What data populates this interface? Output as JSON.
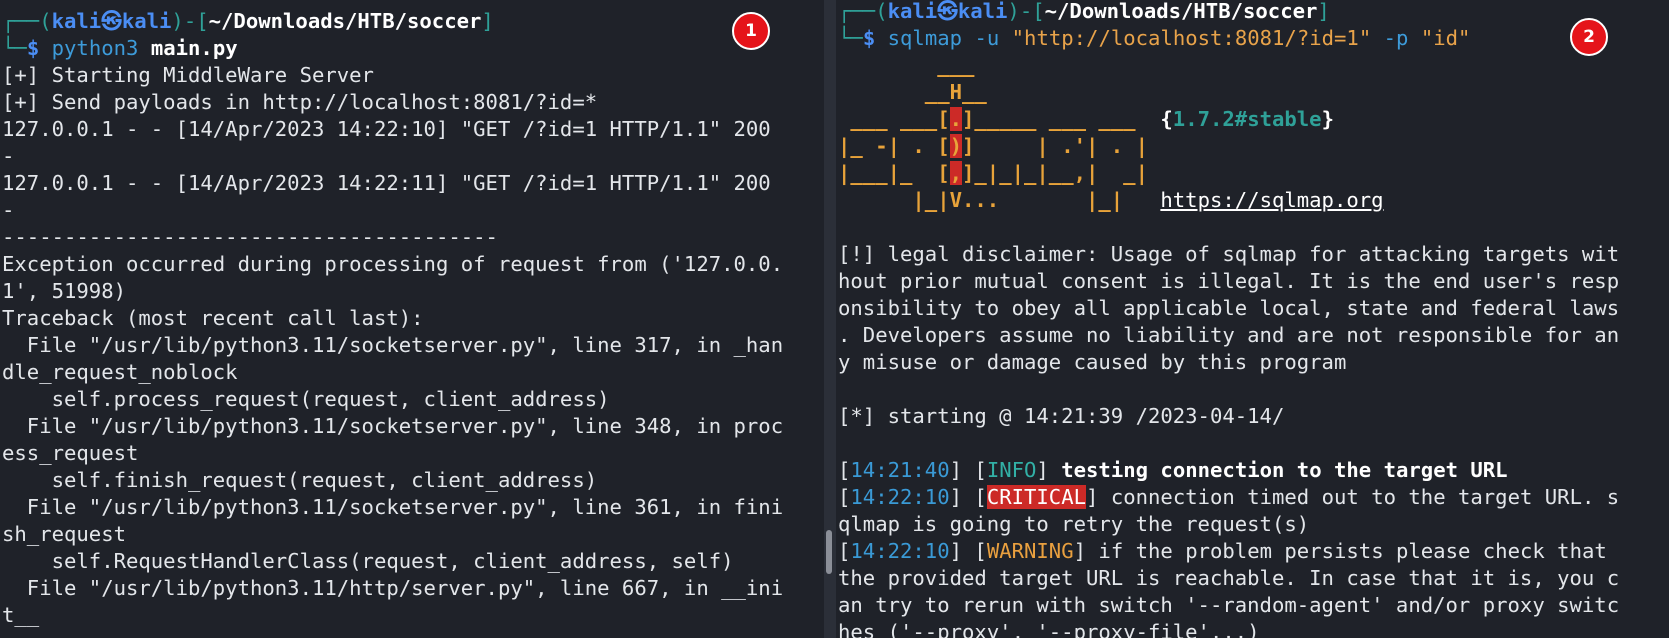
{
  "left": {
    "badge": "1",
    "prompt": {
      "line1_prefix": "┌──(",
      "user": "kali",
      "skull": "㉿",
      "host": "kali",
      "mid": ")-[",
      "path": "~/Downloads/HTB/soccer",
      "end": "]",
      "line2_prefix": "└─",
      "dollar": "$",
      "command": "python3",
      "arg": "main.py"
    },
    "output": [
      "[+] Starting MiddleWare Server",
      "[+] Send payloads in http://localhost:8081/?id=*",
      "127.0.0.1 - - [14/Apr/2023 14:22:10] \"GET /?id=1 HTTP/1.1\" 200",
      "-",
      "127.0.0.1 - - [14/Apr/2023 14:22:11] \"GET /?id=1 HTTP/1.1\" 200",
      "-",
      "----------------------------------------",
      "Exception occurred during processing of request from ('127.0.0.",
      "1', 51998)",
      "Traceback (most recent call last):",
      "  File \"/usr/lib/python3.11/socketserver.py\", line 317, in _han",
      "dle_request_noblock",
      "    self.process_request(request, client_address)",
      "  File \"/usr/lib/python3.11/socketserver.py\", line 348, in proc",
      "ess_request",
      "    self.finish_request(request, client_address)",
      "  File \"/usr/lib/python3.11/socketserver.py\", line 361, in fini",
      "sh_request",
      "    self.RequestHandlerClass(request, client_address, self)",
      "  File \"/usr/lib/python3.11/http/server.py\", line 667, in __ini",
      "t__"
    ]
  },
  "right": {
    "badge": "2",
    "prompt": {
      "line1_prefix": "┌──(",
      "user": "kali",
      "skull": "㉿",
      "host": "kali",
      "mid": ")-[",
      "path": "~/Downloads/HTB/soccer",
      "end": "]",
      "line2_prefix": "└─",
      "dollar": "$",
      "command": "sqlmap",
      "flag_u": "-u",
      "url": "\"http://localhost:8081/?id=1\"",
      "flag_p": "-p",
      "param": "\"id\""
    },
    "logo": {
      "l1": "        ___",
      "l2": "       __H__",
      "l3a": " ___ ___[",
      "l3r": ".",
      "l3b": "]_____ ___ ___  ",
      "l4a": "|_ -| . [",
      "l4r": ")",
      "l4b": "]     | .'| . |",
      "l5a": "|___|_  [",
      "l5r": ",",
      "l5b": "]_|_|_|__,|  _|",
      "l6": "      |_|V...       |_|   ",
      "version_open": "{",
      "version": "1.7.2#stable",
      "version_close": "}",
      "url": "https://sqlmap.org"
    },
    "disclaimer": [
      "[!] legal disclaimer: Usage of sqlmap for attacking targets wit",
      "hout prior mutual consent is illegal. It is the end user's resp",
      "onsibility to obey all applicable local, state and federal laws",
      ". Developers assume no liability and are not responsible for an",
      "y misuse or damage caused by this program"
    ],
    "starting": "[*] starting @ 14:21:39 /2023-04-14/",
    "log": {
      "t1": "14:21:40",
      "lvl1": "INFO",
      "msg1": "testing connection to the target URL",
      "t2": "14:22:10",
      "lvl2": "CRITICAL",
      "msg2a": "connection timed out to the target URL. s",
      "msg2b": "qlmap is going to retry the request(s)",
      "t3": "14:22:10",
      "lvl3": "WARNING",
      "msg3a": "if the problem persists please check that",
      "msg3b": "the provided target URL is reachable. In case that it is, you c",
      "msg3c": "an try to rerun with switch '--random-agent' and/or proxy switc",
      "msg3d": "hes ('--proxy', '--proxy-file'...)"
    }
  }
}
